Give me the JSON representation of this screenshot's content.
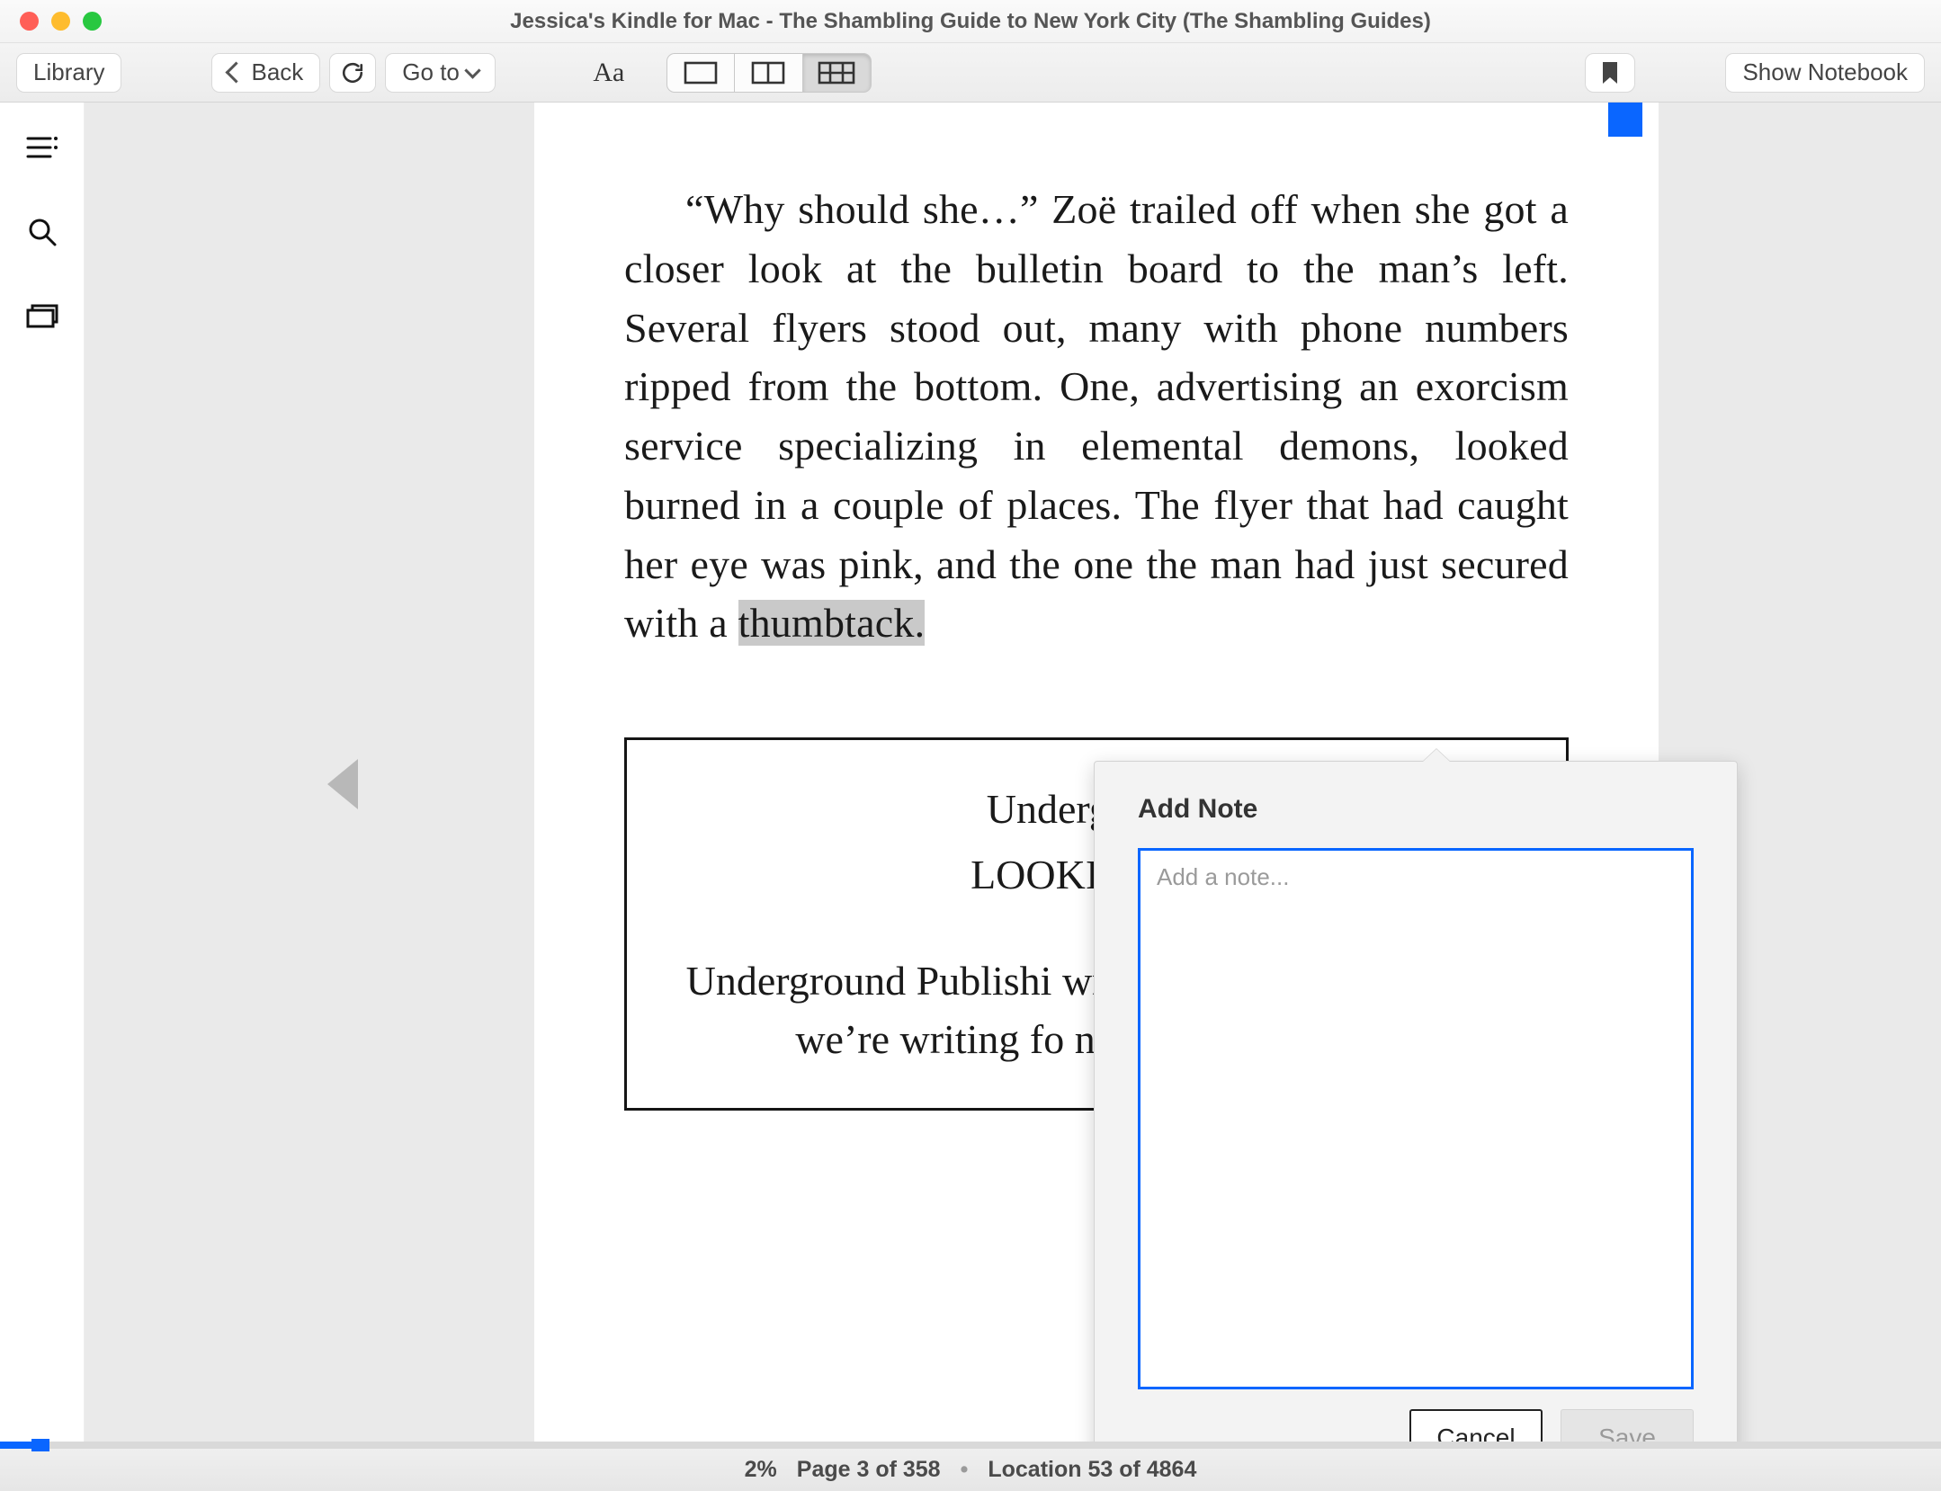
{
  "window": {
    "title": "Jessica's Kindle for Mac - The Shambling Guide to New York City (The Shambling Guides)"
  },
  "toolbar": {
    "library_label": "Library",
    "back_label": "Back",
    "goto_label": "Go to",
    "show_notebook_label": "Show Notebook"
  },
  "page": {
    "paragraph_pre": "“Why should she…” Zoë trailed off when she got a closer look at the bulletin board to the man’s left. Several flyers stood out, many with phone numbers ripped from the bottom. One, advertising an exorcism service specializing in elemental demons, looked burned in a couple of places. The flyer that had caught her eye was pink, and the one the man had just secured with a ",
    "highlighted": "thumbtack.",
    "flyer_title1": "Underground",
    "flyer_title2": "LOOKING FO",
    "flyer_body": "Underground Publishi writing travel guides Since we’re writing fo need people like yo"
  },
  "note_popover": {
    "title": "Add Note",
    "placeholder": "Add a note...",
    "cancel_label": "Cancel",
    "save_label": "Save"
  },
  "footer": {
    "percent": "2%",
    "page": "Page 3 of 358",
    "location": "Location 53 of 4864"
  }
}
